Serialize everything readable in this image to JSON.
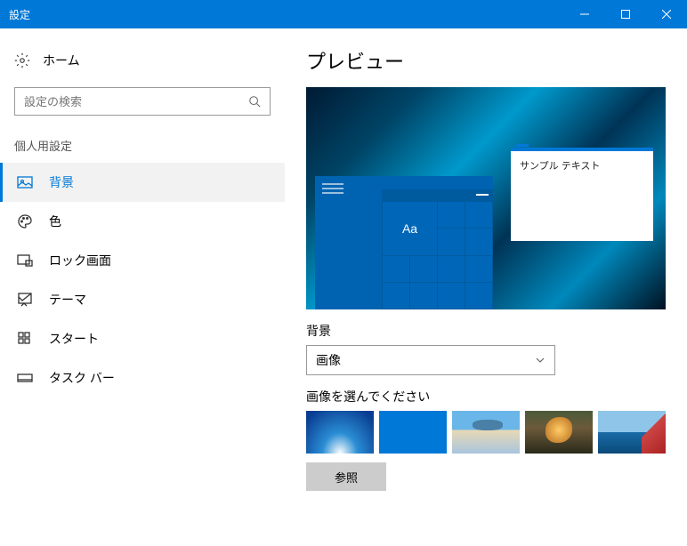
{
  "titlebar": {
    "title": "設定"
  },
  "sidebar": {
    "home": "ホーム",
    "search_placeholder": "設定の検索",
    "section": "個人用設定",
    "items": [
      {
        "label": "背景"
      },
      {
        "label": "色"
      },
      {
        "label": "ロック画面"
      },
      {
        "label": "テーマ"
      },
      {
        "label": "スタート"
      },
      {
        "label": "タスク バー"
      }
    ]
  },
  "main": {
    "heading": "プレビュー",
    "sample_text": "サンプル テキスト",
    "aa": "Aa",
    "bg_label": "背景",
    "bg_value": "画像",
    "choose_label": "画像を選んでください",
    "browse": "参照"
  }
}
